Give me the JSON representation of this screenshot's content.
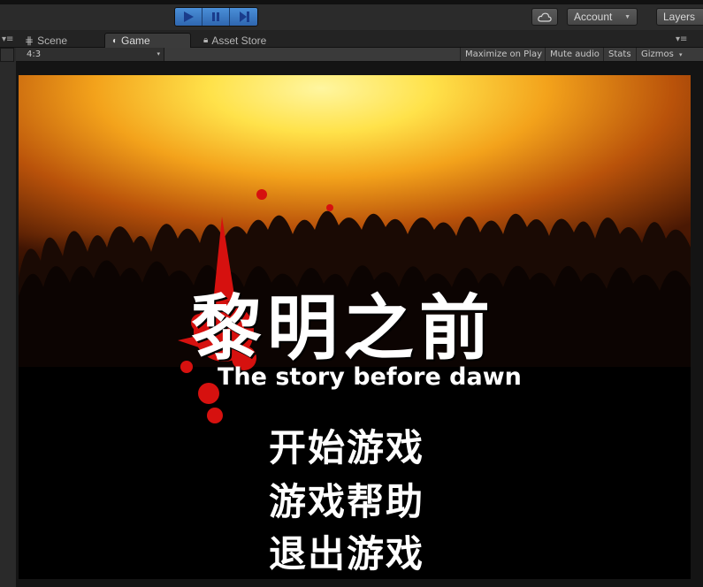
{
  "toolbar": {
    "account_label": "Account",
    "layers_label": "Layers",
    "icons": [
      "play-icon",
      "pause-icon",
      "step-icon",
      "cloud-icon"
    ]
  },
  "tabs": [
    {
      "label": "Scene",
      "icon": "grid-icon"
    },
    {
      "label": "Game",
      "icon": "pacman-icon",
      "active": true
    },
    {
      "label": "Asset Store",
      "icon": "lock-icon"
    }
  ],
  "gamebar": {
    "aspect": "4:3",
    "maximize": "Maximize on Play",
    "mute": "Mute audio",
    "stats": "Stats",
    "gizmos": "Gizmos"
  },
  "game": {
    "title_cn": "黎明之前",
    "title_en": "The story before dawn",
    "menu": {
      "start": "开始游戏",
      "help": "游戏帮助",
      "quit": "退出游戏"
    },
    "colors": {
      "sky_top": "#fff37a",
      "sky_mid": "#f2a11a",
      "sky_edge": "#7a2a05",
      "blood": "#d6110f"
    }
  }
}
